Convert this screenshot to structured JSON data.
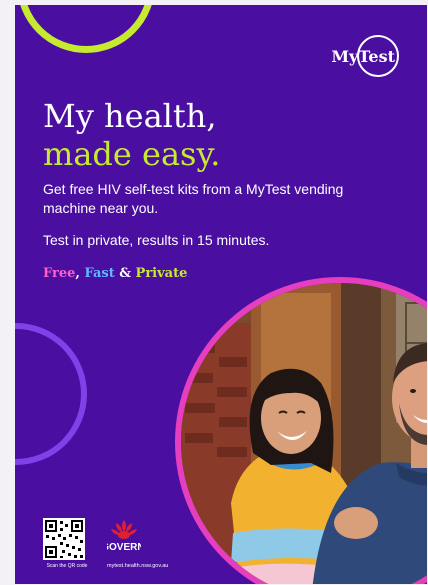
{
  "brand": {
    "logo_text": "MyTest",
    "colors": {
      "background": "#4a0ea1",
      "lime": "#c6ea2f",
      "pink": "#e53fbf",
      "blue": "#5fb9ff",
      "violet": "#7f42e8"
    }
  },
  "headline": {
    "line1": "My health,",
    "line2": "made easy."
  },
  "body": {
    "paragraph1": "Get free HIV self-test kits from a MyTest vending machine near you.",
    "paragraph2": "Test in private, results in 15 minutes."
  },
  "tagline": {
    "free": "Free",
    "comma": ",",
    "fast": "Fast",
    "amp": "&",
    "private": "Private"
  },
  "footer": {
    "qr_label": "Scan the QR code",
    "government_logo_text": "NSW GOVERNMENT",
    "url": "mytest.health.nsw.gov.au"
  },
  "icons": [
    "qr-code-icon",
    "waratah-icon"
  ]
}
